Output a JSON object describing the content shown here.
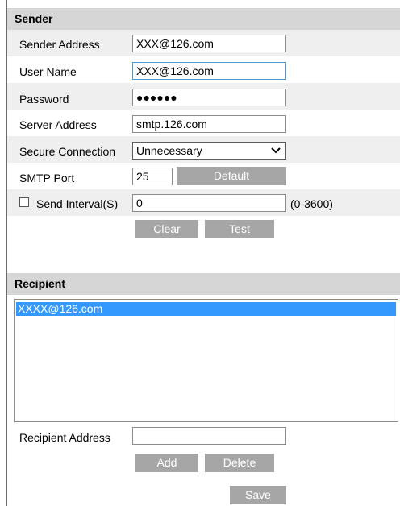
{
  "sender": {
    "header": "Sender",
    "sender_address": {
      "label": "Sender Address",
      "value": "XXX@126.com"
    },
    "user_name": {
      "label": "User Name",
      "value": "XXX@126.com"
    },
    "password": {
      "label": "Password",
      "masked_value": "●●●●●●"
    },
    "server_address": {
      "label": "Server Address",
      "value": "smtp.126.com"
    },
    "secure_connection": {
      "label": "Secure Connection",
      "selected": "Unnecessary"
    },
    "smtp_port": {
      "label": "SMTP Port",
      "value": "25",
      "default_button": "Default"
    },
    "send_interval": {
      "label": "Send Interval(S)",
      "checked": false,
      "value": "0",
      "range": "(0-3600)"
    },
    "clear_button": "Clear",
    "test_button": "Test"
  },
  "recipient": {
    "header": "Recipient",
    "list": [
      "XXXX@126.com"
    ],
    "address": {
      "label": "Recipient Address",
      "value": ""
    },
    "add_button": "Add",
    "delete_button": "Delete"
  },
  "save_button": "Save",
  "colors": {
    "header_bg": "#d6d6d6",
    "row_alt_bg": "#efefef",
    "button_bg": "#a6a6a6",
    "selection_bg": "#3399ff",
    "focus_border": "#4a9bd6"
  }
}
